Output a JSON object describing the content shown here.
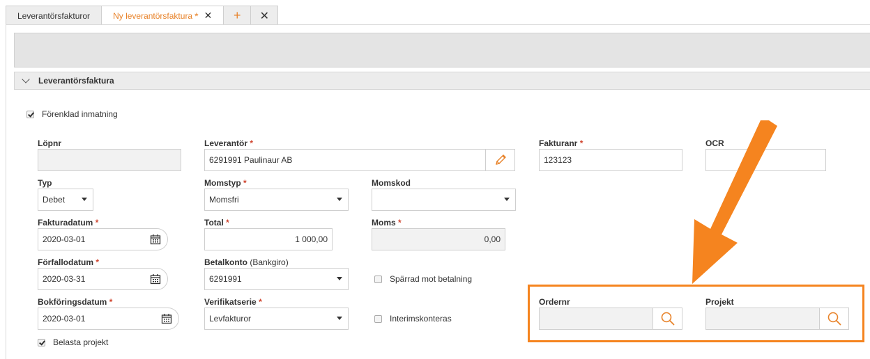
{
  "tabs": {
    "t1": "Leverantörsfakturor",
    "t2": "Ny leverantörsfaktura",
    "t2_star": "*",
    "close": "✕",
    "plus": "+"
  },
  "section": {
    "title": "Leverantörsfaktura"
  },
  "simplified": {
    "label": "Förenklad inmatning",
    "checked": true
  },
  "fields": {
    "lopnr": {
      "label": "Löpnr",
      "value": ""
    },
    "leverantor": {
      "label": "Leverantör",
      "value": "6291991 Paulinaur AB"
    },
    "fakturanr": {
      "label": "Fakturanr",
      "value": "123123"
    },
    "ocr": {
      "label": "OCR",
      "value": ""
    },
    "typ": {
      "label": "Typ",
      "value": "Debet"
    },
    "momstyp": {
      "label": "Momstyp",
      "value": "Momsfri"
    },
    "momskod": {
      "label": "Momskod",
      "value": ""
    },
    "fakturadatum": {
      "label": "Fakturadatum",
      "value": "2020-03-01"
    },
    "total": {
      "label": "Total",
      "value": "1 000,00"
    },
    "moms": {
      "label": "Moms",
      "value": "0,00"
    },
    "forfallodatum": {
      "label": "Förfallodatum",
      "value": "2020-03-31"
    },
    "betalkonto": {
      "label": "Betalkonto",
      "sub": "(Bankgiro)",
      "value": "6291991"
    },
    "sparrad": {
      "label": "Spärrad mot betalning",
      "checked": false
    },
    "bokforingsdatum": {
      "label": "Bokföringsdatum",
      "value": "2020-03-01"
    },
    "verifikatserie": {
      "label": "Verifikatserie",
      "value": "Levfakturor"
    },
    "interims": {
      "label": "Interimskonteras",
      "checked": false
    },
    "ordernr": {
      "label": "Ordernr",
      "value": ""
    },
    "projekt": {
      "label": "Projekt",
      "value": ""
    },
    "belasta": {
      "label": "Belasta projekt",
      "checked": true
    }
  },
  "required_marker": "*",
  "colors": {
    "accent": "#f5841f",
    "required": "#d0452f"
  }
}
